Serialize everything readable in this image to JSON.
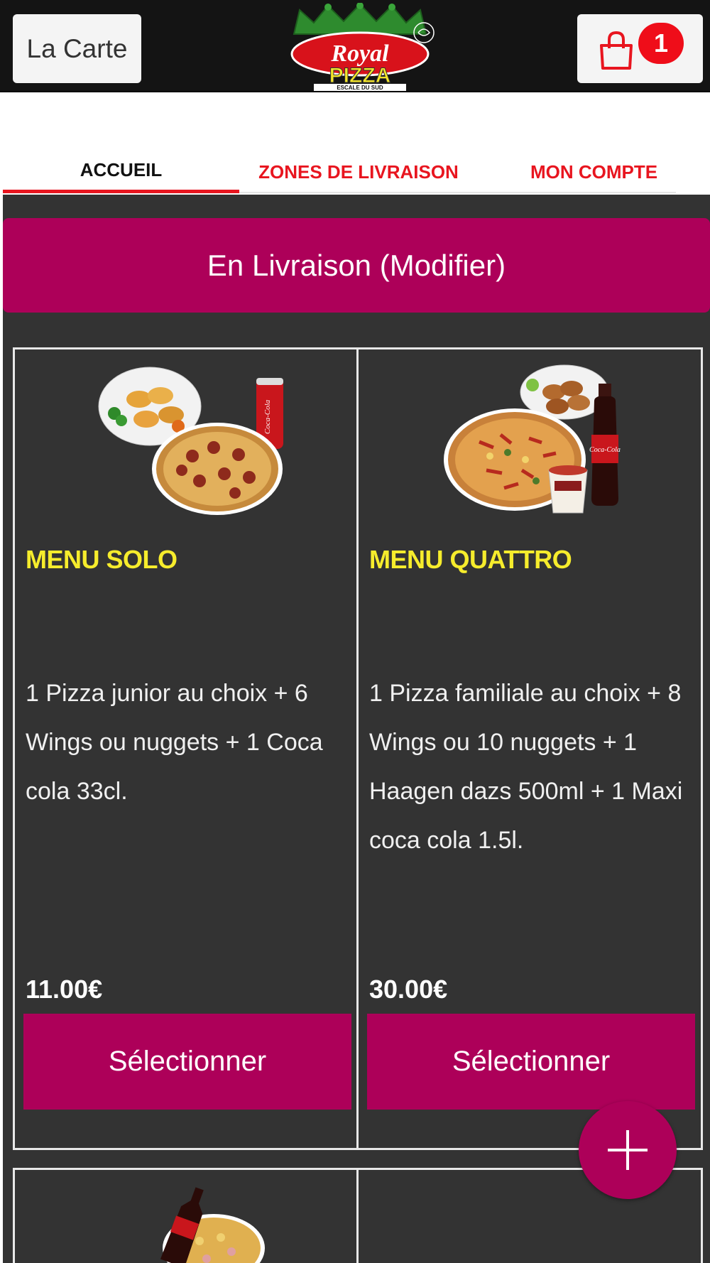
{
  "header": {
    "menu_button_label": "La Carte",
    "logo_text": "Royal PIZZA",
    "logo_subtext": "ESCALE DU SUD",
    "cart_icon": "shopping-bag-icon",
    "cart_count": "1"
  },
  "nav": {
    "tabs": [
      {
        "label": "ACCUEIL",
        "active": true
      },
      {
        "label": "ZONES DE LIVRAISON",
        "active": false
      },
      {
        "label": "MON COMPTE",
        "active": false
      }
    ]
  },
  "delivery_mode_label": "En Livraison (Modifier)",
  "products": [
    {
      "title": "MENU SOLO",
      "description": "1 Pizza junior au choix  + 6 Wings ou nuggets  + 1 Coca cola 33cl.",
      "price": "11.00€",
      "button_label": "Sélectionner"
    },
    {
      "title": "MENU QUATTRO",
      "description": "1 Pizza familiale au choix  + 8 Wings ou 10 nuggets  + 1 Haagen dazs 500ml  + 1 Maxi coca cola 1.5l.",
      "price": "30.00€",
      "button_label": "Sélectionner"
    }
  ],
  "fab_icon": "plus-icon",
  "colors": {
    "accent": "#ad0059",
    "nav_red": "#e8151f",
    "title_yellow": "#f6ec2c",
    "background": "#333333",
    "header_bg": "#141414"
  }
}
